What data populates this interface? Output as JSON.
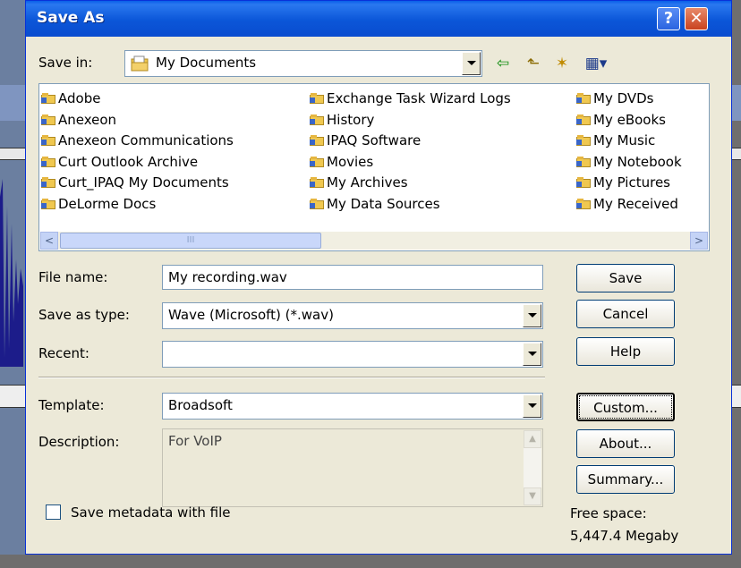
{
  "window": {
    "title": "Save As",
    "help_glyph": "?",
    "close_glyph": "✕"
  },
  "save_in": {
    "label": "Save in:",
    "value": "My Documents",
    "icon": "my-documents-icon"
  },
  "toolbar": {
    "back_icon": "⇦",
    "up_icon": "⬑",
    "new_folder_icon": "✶",
    "views_icon": "▦▾"
  },
  "folders": {
    "col1": [
      "Adobe",
      "Anexeon",
      "Anexeon Communications",
      "Curt Outlook Archive",
      "Curt_IPAQ My Documents",
      "DeLorme Docs"
    ],
    "col2": [
      "Exchange Task Wizard Logs",
      "History",
      "IPAQ Software",
      "Movies",
      "My Archives",
      "My Data Sources"
    ],
    "col3": [
      "My DVDs",
      "My eBooks",
      "My Music",
      "My Notebook",
      "My Pictures",
      "My Received"
    ]
  },
  "scroll": {
    "left_arrow": "<",
    "right_arrow": ">",
    "thumb_grip": "III"
  },
  "form": {
    "file_name_label": "File name:",
    "file_name_value": "My recording.wav",
    "save_as_type_label": "Save as type:",
    "save_as_type_value": "Wave (Microsoft) (*.wav)",
    "recent_label": "Recent:",
    "recent_value": "",
    "template_label": "Template:",
    "template_value": "Broadsoft",
    "description_label": "Description:",
    "description_value": "For VoIP",
    "metadata_checkbox_label": "Save metadata with file"
  },
  "buttons": {
    "save": "Save",
    "cancel": "Cancel",
    "help": "Help",
    "custom": "Custom...",
    "about": "About...",
    "summary": "Summary..."
  },
  "free_space": {
    "label": "Free space:",
    "value": "5,447.4 Megaby"
  },
  "colors": {
    "titlebar": "#0a56d8",
    "dialog_bg": "#ece9d8"
  }
}
